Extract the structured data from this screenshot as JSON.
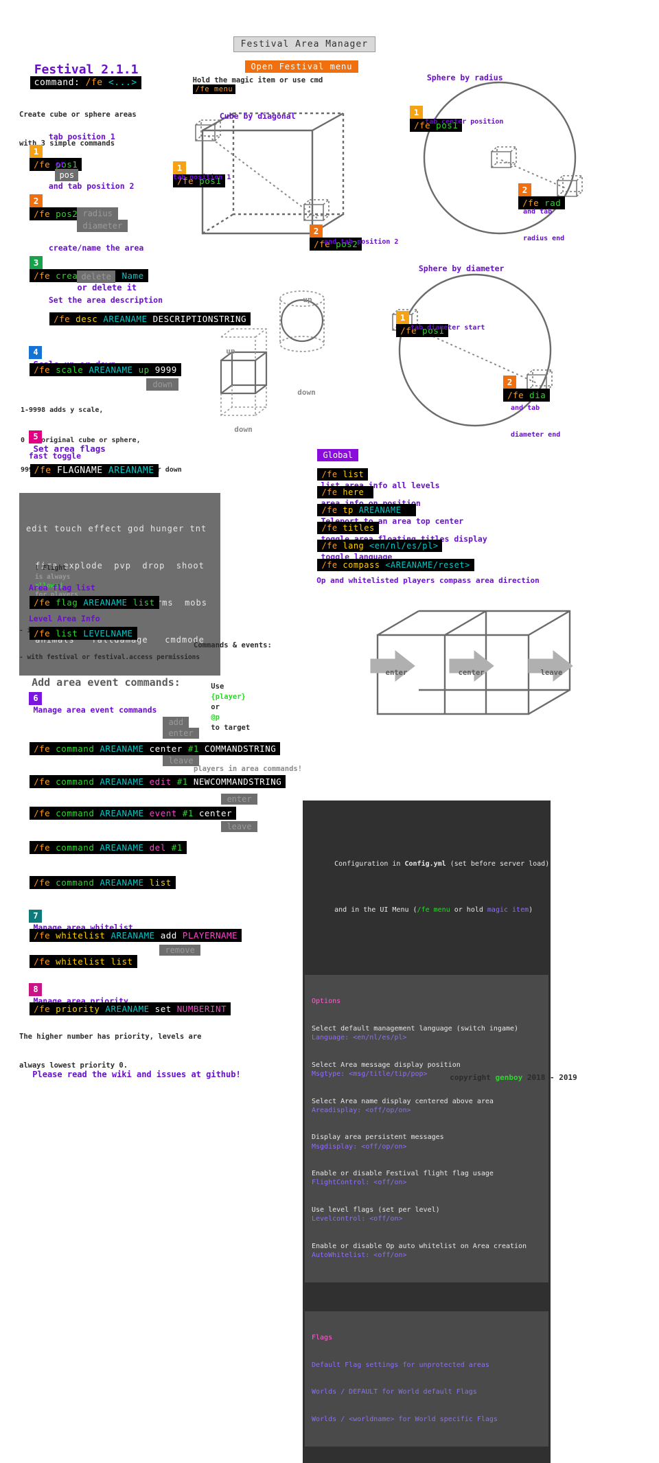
{
  "header": {
    "window_title": "Festival Area Manager",
    "open_menu_button": "Open Festival menu",
    "hold_hint_prefix": "Hold the magic item or use cmd",
    "hold_hint_cmd": "/fe menu"
  },
  "intro": {
    "title": "Festival 2.1.1",
    "command_label": "command:",
    "command_fe": "/fe",
    "command_args": "<...>",
    "subtitle_line1": "Create cube or sphere areas",
    "subtitle_line2": "with 3 simple commands"
  },
  "steps": {
    "s1": {
      "num": "1",
      "caption": "tab position 1",
      "cmd_fe": "/fe",
      "cmd_arg": "pos1",
      "or_label": "or",
      "alt": "pos"
    },
    "s2": {
      "num": "2",
      "caption": "and tab position 2",
      "cmd_fe": "/fe",
      "cmd_arg": "pos2",
      "alt1": "radius",
      "alt2": "diameter"
    },
    "s3": {
      "num": "3",
      "caption": "create/name the area",
      "cmd_fe": "/fe",
      "cmd_verb": "create",
      "cmd_arg": "Area Name",
      "alt": "delete",
      "alt_text": "or delete it"
    },
    "desc": {
      "caption": "Set the area description",
      "cmd_fe": "/fe",
      "cmd_verb": "desc",
      "cmd_area": "AREANAME",
      "cmd_str": "DESCRIPTIONSTRING"
    },
    "s4": {
      "num": "4",
      "caption": "Scale up or down",
      "cmd_fe": "/fe",
      "cmd_verb": "scale",
      "cmd_area": "AREANAME",
      "cmd_dir": "up",
      "cmd_val": "9999",
      "alt": "down",
      "note1": "1-9998 adds y scale,",
      "note2": "0 is original cube or sphere,",
      "note3": "9999 gives unlimited y scale up or down"
    },
    "s5": {
      "num": "5",
      "caption": "Set area flags",
      "fast_toggle": "fast toggle",
      "cmd_fe": "/fe",
      "cmd_flag": "FLAGNAME",
      "cmd_area": "AREANAME",
      "flags_rows": [
        "edit touch effect god hunger tnt",
        "fire explode  pvp  drop  shoot",
        "flight  pass  msg   perms  mobs",
        "animals   falldamage   cmdmode"
      ],
      "flight_note_a": "! Flight",
      "flight_note_b": "is always",
      "flight_note_c": "allowed",
      "flight_note_d": "for players",
      "flight_note_e": "- in creative mode",
      "flight_note_f": "- with festival or festival.access permissions",
      "flaglist_caption": "Area flag list",
      "flaglist_fe": "/fe",
      "flaglist_verb": "flag",
      "flaglist_area": "AREANAME",
      "flaglist_arg": "list",
      "levelinfo_caption": "Level Area Info",
      "levelinfo_fe": "/fe",
      "levelinfo_verb": "list",
      "levelinfo_arg": "LEVELNAME"
    }
  },
  "diagrams": {
    "cube_by_diagonal": "Cube by diagonal",
    "cube_pos1_num": "1",
    "cube_pos1_cmd_fe": "/fe",
    "cube_pos1_cmd_arg": "pos1",
    "cube_pos1_label": "tab position 1",
    "cube_pos2_num": "2",
    "cube_pos2_cmd_fe": "/fe",
    "cube_pos2_cmd_arg": "pos2",
    "cube_pos2_label": "and tab position 2",
    "sphere_by_radius": "Sphere by radius",
    "rad_pos1_num": "1",
    "rad_pos1_cmd_fe": "/fe",
    "rad_pos1_cmd_arg": "pos1",
    "rad_pos1_label": "tab center position",
    "rad_num": "2",
    "rad_cmd_fe": "/fe",
    "rad_cmd_arg": "rad",
    "rad_label_1": "and tab",
    "rad_label_2": "radius end",
    "sphere_by_diameter": "Sphere by diameter",
    "dia_pos1_num": "1",
    "dia_pos1_cmd_fe": "/fe",
    "dia_pos1_cmd_arg": "pos1",
    "dia_pos1_label": "tab diameter start",
    "dia_num": "2",
    "dia_cmd_fe": "/fe",
    "dia_cmd_arg": "dia",
    "dia_label_1": "and tab",
    "dia_label_2": "diameter end",
    "scale_up": "up",
    "scale_down": "down",
    "enter": "enter",
    "center": "center",
    "leave": "leave"
  },
  "global": {
    "badge": "Global",
    "rows": [
      {
        "fe": "/fe",
        "verb": "list",
        "arg": "",
        "desc": "list area info all levels"
      },
      {
        "fe": "/fe",
        "verb": "here",
        "arg": "",
        "desc": "area info on position"
      },
      {
        "fe": "/fe",
        "verb": "tp",
        "arg": "AREANAME",
        "desc": "Teleport to an area top center"
      },
      {
        "fe": "/fe",
        "verb": "titles",
        "arg": "",
        "desc": "toggle area floating titles display"
      },
      {
        "fe": "/fe",
        "verb": "lang",
        "arg": "<en/nl/es/pl>",
        "desc": "toggle language"
      },
      {
        "fe": "/fe",
        "verb": "compass",
        "arg": "<AREANAME/reset>",
        "desc": ""
      }
    ],
    "compass_note": "Op and whitelisted players compass area direction"
  },
  "events": {
    "note_title": "Commands & events:",
    "note_l1_a": "Use",
    "note_l1_b": "{player}",
    "note_l1_c": "or",
    "note_l1_d": "@p",
    "note_l1_e": "to target",
    "note_l2": "players in area commands!",
    "section_title": "Add area event commands:",
    "s6_num": "6",
    "s6_caption": "Manage area event commands",
    "add_chip_1": "add",
    "add_chip_2": "enter",
    "add_chip_3": "leave",
    "row_add": {
      "fe": "/fe",
      "verb": "command",
      "area": "AREANAME",
      "mid": "center",
      "idx": "#1",
      "str": "COMMANDSTRING"
    },
    "row_edit": {
      "fe": "/fe",
      "verb": "command",
      "area": "AREANAME",
      "mid": "edit",
      "idx": "#1",
      "str": "NEWCOMMANDSTRING"
    },
    "row_event": {
      "fe": "/fe",
      "verb": "command",
      "area": "AREANAME",
      "mid": "event",
      "idx": "#1",
      "str": "center"
    },
    "ev_chip_1": "enter",
    "ev_chip_2": "leave",
    "row_del": {
      "fe": "/fe",
      "verb": "command",
      "area": "AREANAME",
      "mid": "del",
      "idx": "#1"
    },
    "row_list": {
      "fe": "/fe",
      "verb": "command",
      "area": "AREANAME",
      "mid": "list"
    }
  },
  "whitelist": {
    "num": "7",
    "caption": "Manage area whitelist",
    "row_add": {
      "fe": "/fe",
      "verb": "whitelist",
      "area": "AREANAME",
      "mid": "add",
      "player": "PLAYERNAME"
    },
    "alt": "remove",
    "row_list": {
      "fe": "/fe",
      "verb": "whitelist",
      "arg": "list"
    }
  },
  "priority": {
    "num": "8",
    "caption": "Manage area priority",
    "row": {
      "fe": "/fe",
      "verb": "priority",
      "area": "AREANAME",
      "mid": "set",
      "val": "NUMBERINT"
    },
    "note1": "The higher number has priority, levels are",
    "note2": "always lowest priority 0."
  },
  "config": {
    "head_l1_a": "Configuration in ",
    "head_l1_b": "Config.yml",
    "head_l1_c": " (set before server load)",
    "head_l2_a": "and in the UI Menu (",
    "head_l2_b": "/fe menu",
    "head_l2_c": " or hold ",
    "head_l2_d": "magic item",
    "head_l2_e": ")",
    "options_title": "Options",
    "options": [
      {
        "desc": "Select default management language (switch ingame)",
        "key": "Language: <en/nl/es/pl>"
      },
      {
        "desc": "Select Area message display position",
        "key": "Msgtype: <msg/title/tip/pop>"
      },
      {
        "desc": "Select Area name display centered above area",
        "key": "Areadisplay: <off/op/on>"
      },
      {
        "desc": "Display area persistent messages",
        "key": "Msgdisplay: <off/op/on>"
      },
      {
        "desc": "Enable or disable Festival flight flag usage",
        "key": "FlightControl: <off/on>"
      },
      {
        "desc": "Use level flags (set per level)",
        "key": "Levelcontrol: <off/on>"
      },
      {
        "desc": "Enable or disable Op auto whitelist on Area creation",
        "key": "AutoWhitelist: <off/on>"
      }
    ],
    "flags_title": "Flags",
    "flags_lines": [
      "Default Flag settings for unprotected areas",
      "Worlds / DEFAULT for World default Flags",
      "Worlds / <worldname> for World specific Flags"
    ]
  },
  "footer": {
    "left": "Please read the wiki and issues at github!",
    "right_a": "copyright ",
    "right_b": "genboy",
    "right_c": " 2018 - 2019"
  },
  "colors": {
    "accent_purple": "#6a0dd0",
    "orange": "#ff9b1a",
    "green": "#2fd42f",
    "cyan": "#00c8c8",
    "magenta": "#ff3fd0"
  }
}
